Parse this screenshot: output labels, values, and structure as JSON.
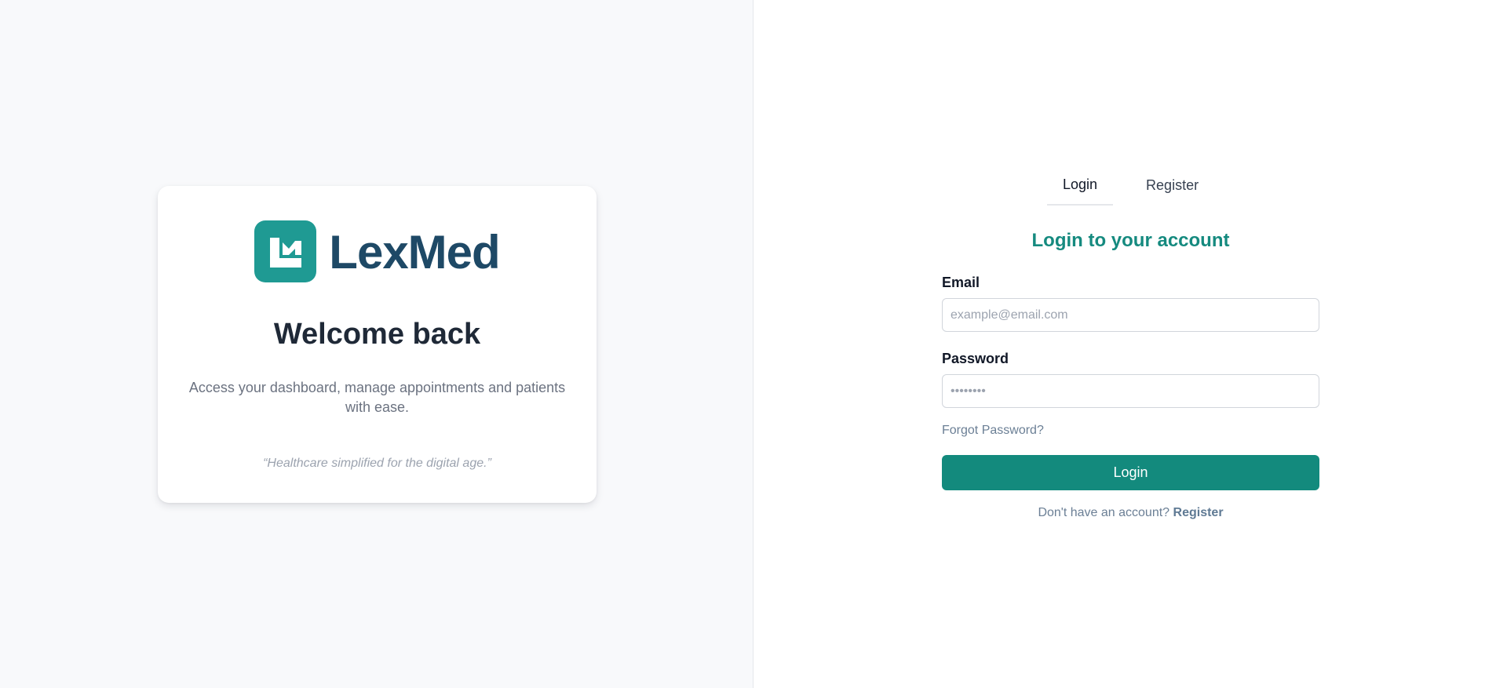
{
  "brand": {
    "name": "LexMed",
    "logo_icon": "lexmed-logo-icon",
    "primary_color": "#1f9a93",
    "text_color": "#1e4966"
  },
  "welcome_card": {
    "title": "Welcome back",
    "description": "Access your dashboard, manage appointments and patients with ease.",
    "quote": "“Healthcare simplified for the digital age.”"
  },
  "tabs": [
    {
      "label": "Login",
      "active": true
    },
    {
      "label": "Register",
      "active": false
    }
  ],
  "login_form": {
    "title": "Login to your account",
    "email": {
      "label": "Email",
      "placeholder": "example@email.com",
      "value": ""
    },
    "password": {
      "label": "Password",
      "placeholder": "••••••••",
      "value": ""
    },
    "forgot_password": "Forgot Password?",
    "submit_label": "Login",
    "no_account_text": "Don't have an account?",
    "register_link": "Register",
    "accent_color": "#138a7d"
  }
}
